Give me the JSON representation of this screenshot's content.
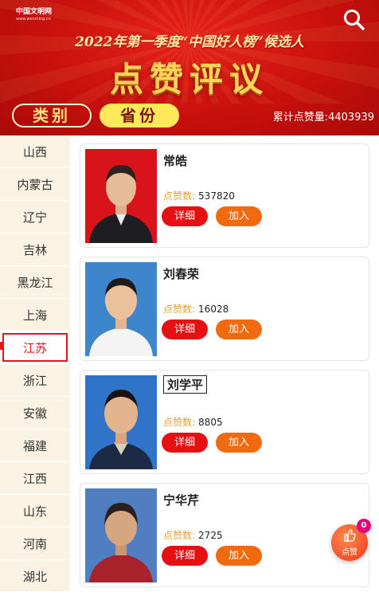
{
  "header": {
    "logo_cn": "中国文明网",
    "logo_en": "www.wenming.cn",
    "subtitle": "2022年第一季度“中国好人榜”候选人",
    "title": "点赞评议",
    "category_label": "类别",
    "province_label": "省份",
    "total_label": "累计点赞量",
    "total_value": "4403939",
    "search_icon": "search-icon"
  },
  "sidebar": {
    "items": [
      "山西",
      "内蒙古",
      "辽宁",
      "吉林",
      "黑龙江",
      "上海",
      "江苏",
      "浙江",
      "安徽",
      "福建",
      "江西",
      "山东",
      "河南",
      "湖北"
    ],
    "active": "江苏"
  },
  "candidates": [
    {
      "name": "常皓",
      "votes_label": "点赞数:",
      "votes": "537820",
      "detail_label": "详细",
      "join_label": "加入"
    },
    {
      "name": "刘春荣",
      "votes_label": "点赞数:",
      "votes": "16028",
      "detail_label": "详细",
      "join_label": "加入"
    },
    {
      "name": "刘学平",
      "votes_label": "点赞数:",
      "votes": "8805",
      "detail_label": "详细",
      "join_label": "加入"
    },
    {
      "name": "宁华芹",
      "votes_label": "点赞数:",
      "votes": "2725",
      "detail_label": "详细",
      "join_label": "加入"
    }
  ],
  "like_fab": {
    "label": "点赞",
    "count": "0",
    "icon": "thumbs-up-icon"
  },
  "colors": {
    "accent_red": "#e60f12",
    "accent_orange": "#f26a10",
    "vote_label": "#e8a03a",
    "sidebar_bg": "#faf3e3"
  }
}
